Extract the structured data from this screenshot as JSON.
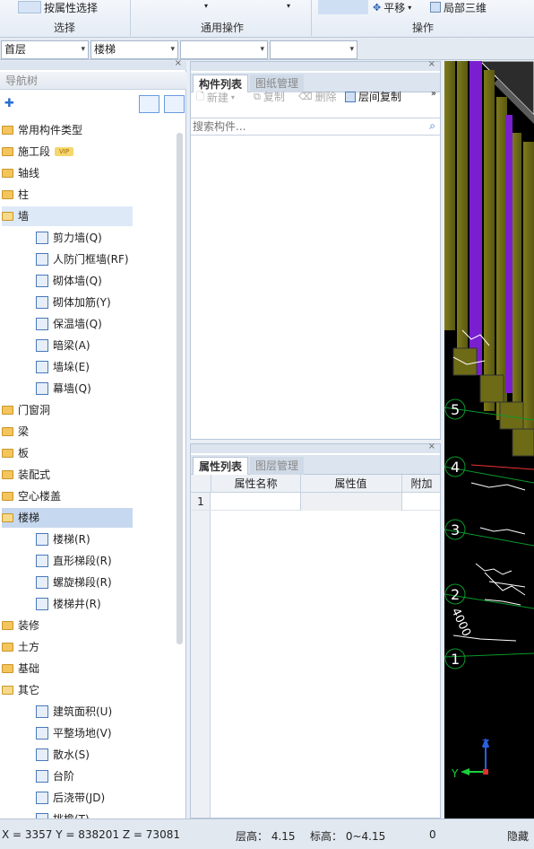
{
  "ribbon": {
    "select_by_attr": "按属性选择",
    "groups": [
      "选择",
      "通用操作",
      "操作"
    ],
    "pan": "平移",
    "local_3d": "局部三维"
  },
  "floorbar": {
    "floor": "首层",
    "component_type": "楼梯",
    "combo3": "",
    "combo4": ""
  },
  "nav": {
    "title": "导航树",
    "items": [
      {
        "label": "常用构件类型"
      },
      {
        "label": "施工段",
        "badge": "VIP"
      },
      {
        "label": "轴线"
      },
      {
        "label": "柱"
      },
      {
        "label": "墙"
      },
      {
        "label": "剪力墙(Q)"
      },
      {
        "label": "人防门框墙(RF)"
      },
      {
        "label": "砌体墙(Q)"
      },
      {
        "label": "砌体加筋(Y)"
      },
      {
        "label": "保温墙(Q)"
      },
      {
        "label": "暗梁(A)"
      },
      {
        "label": "墙垛(E)"
      },
      {
        "label": "幕墙(Q)"
      },
      {
        "label": "门窗洞"
      },
      {
        "label": "梁"
      },
      {
        "label": "板"
      },
      {
        "label": "装配式"
      },
      {
        "label": "空心楼盖"
      },
      {
        "label": "楼梯"
      },
      {
        "label": "楼梯(R)"
      },
      {
        "label": "直形梯段(R)"
      },
      {
        "label": "螺旋梯段(R)"
      },
      {
        "label": "楼梯井(R)"
      },
      {
        "label": "装修"
      },
      {
        "label": "土方"
      },
      {
        "label": "基础"
      },
      {
        "label": "其它"
      },
      {
        "label": "建筑面积(U)"
      },
      {
        "label": "平整场地(V)"
      },
      {
        "label": "散水(S)"
      },
      {
        "label": "台阶"
      },
      {
        "label": "后浇带(JD)"
      },
      {
        "label": "挑檐(T)"
      }
    ]
  },
  "comp": {
    "tab_active": "构件列表",
    "tab_inactive": "图纸管理",
    "new": "新建",
    "copy": "复制",
    "delete": "删除",
    "floor_copy": "层间复制",
    "search_placeholder": "搜索构件..."
  },
  "prop": {
    "tab_active": "属性列表",
    "tab_inactive": "图层管理",
    "col_name": "属性名称",
    "col_value": "属性值",
    "col_extra": "附加",
    "row1": "1"
  },
  "view": {
    "axis_labels": [
      "5",
      "4",
      "3",
      "2",
      "1"
    ],
    "dim_text": "4000",
    "z_axis": "Z",
    "y_axis": "Y"
  },
  "status": {
    "coords": "X = 3357 Y = 838201 Z = 73081",
    "floor_height": "层高：  4.15",
    "elevation": "标高：  0~4.15",
    "value": "0",
    "hidden": "隐藏"
  },
  "colors": {
    "purple": "#7b1fd6",
    "olive": "#7a7a1a",
    "accent": "#4a79b8"
  }
}
